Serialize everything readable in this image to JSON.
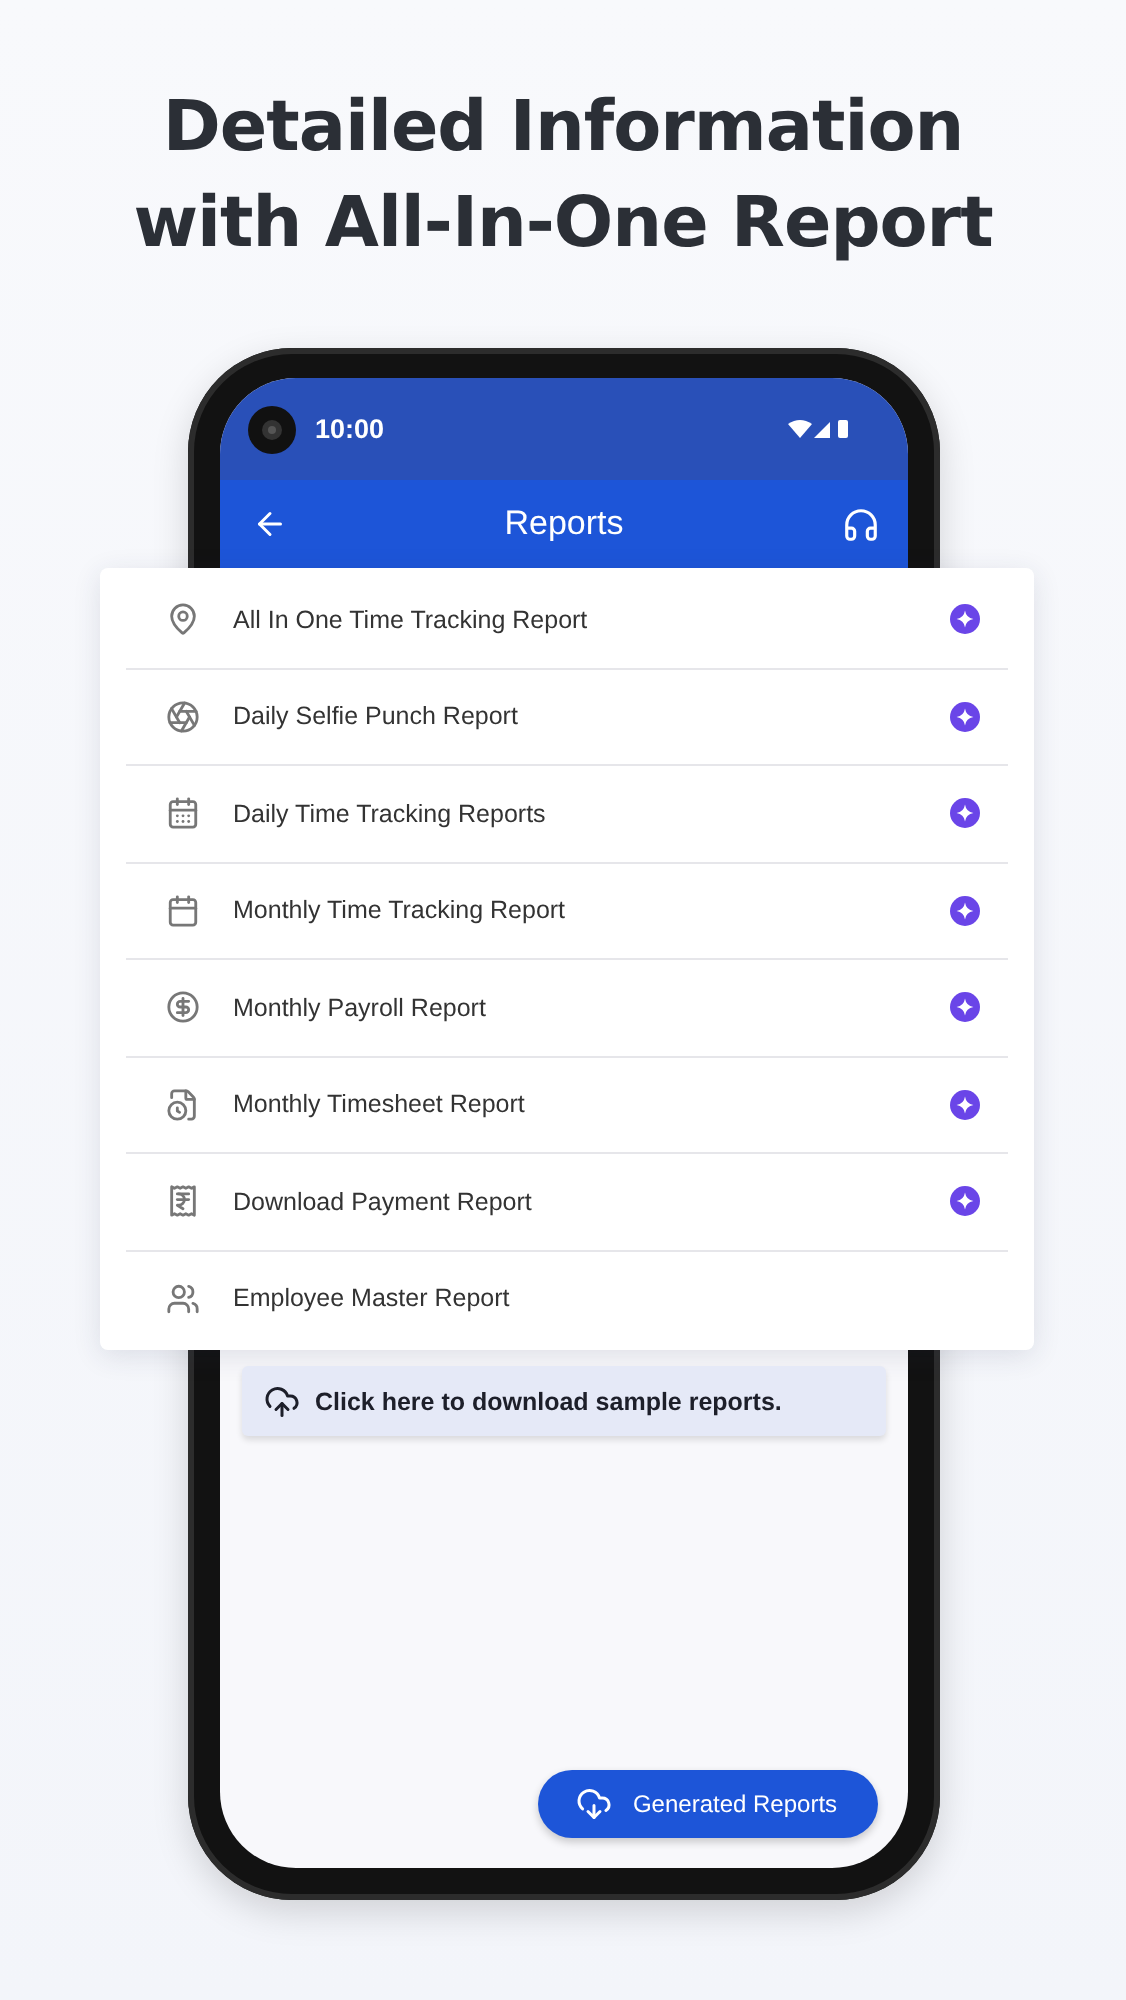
{
  "headline": [
    "Detailed Information",
    "with All-In-One Report"
  ],
  "status_bar": {
    "time": "10:00"
  },
  "app_bar": {
    "title": "Reports"
  },
  "reports": [
    {
      "label": "All In One Time Tracking Report",
      "action": true
    },
    {
      "label": "Daily Selfie Punch Report",
      "action": true
    },
    {
      "label": "Daily Time Tracking Reports",
      "action": true
    },
    {
      "label": "Monthly Time Tracking Report",
      "action": true
    },
    {
      "label": "Monthly Payroll Report",
      "action": true
    },
    {
      "label": "Monthly Timesheet Report",
      "action": true
    },
    {
      "label": "Download Payment Report",
      "action": true
    },
    {
      "label": "Employee Master Report",
      "action": false
    }
  ],
  "sample_link": "Click here to download sample reports.",
  "generated_button": "Generated Reports"
}
